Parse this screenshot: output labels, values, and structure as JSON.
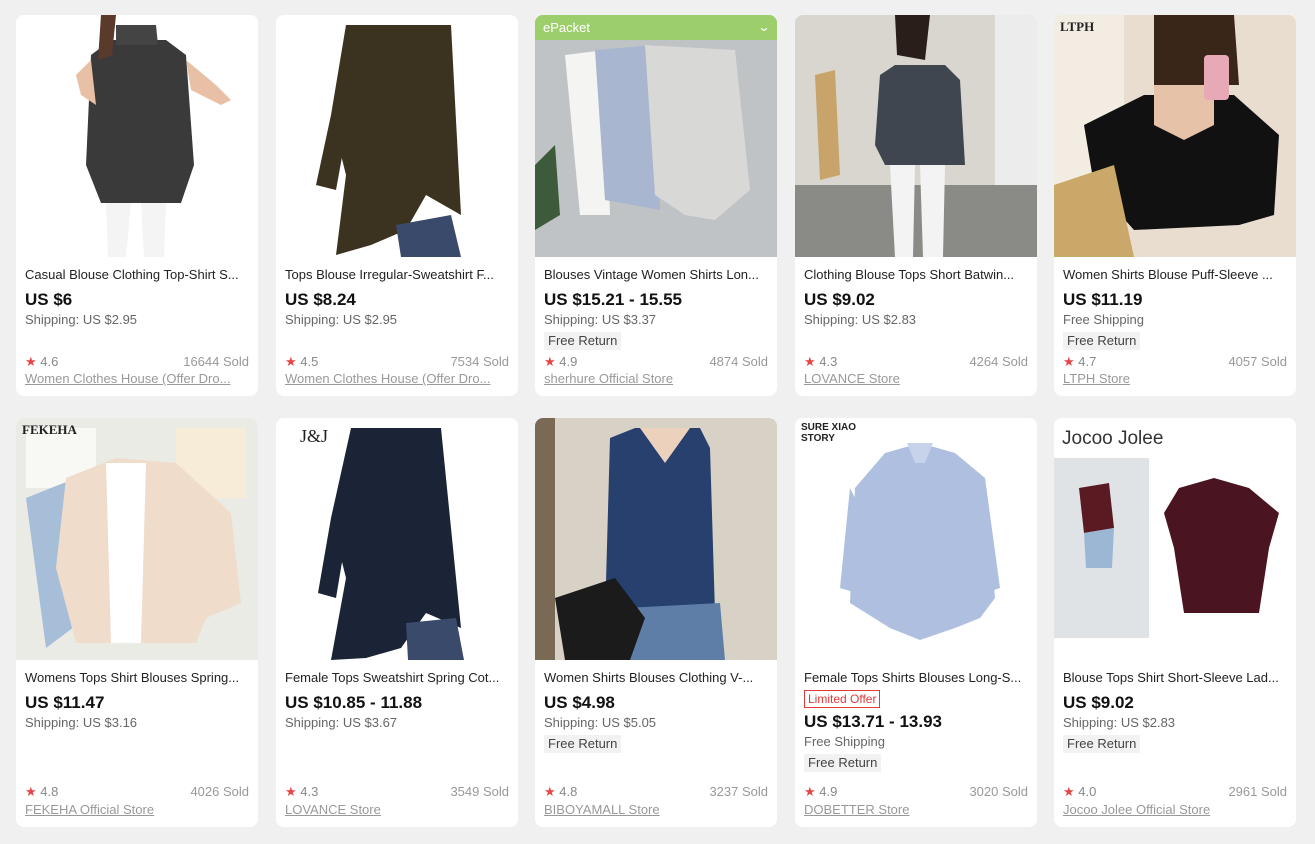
{
  "products": [
    {
      "title": "Casual Blouse Clothing Top-Shirt S...",
      "price": "US $6",
      "shipping": "Shipping: US $2.95",
      "rating": "4.6",
      "sold": "16644 Sold",
      "store": "Women Clothes House (Offer Dro...",
      "badge": "",
      "image_label": ""
    },
    {
      "title": "Tops Blouse Irregular-Sweatshirt F...",
      "price": "US $8.24",
      "shipping": "Shipping: US $2.95",
      "rating": "4.5",
      "sold": "7534 Sold",
      "store": "Women Clothes House (Offer Dro...",
      "badge": "",
      "image_label": ""
    },
    {
      "title": "Blouses Vintage Women Shirts Lon...",
      "price": "US $15.21 - 15.55",
      "shipping": "Shipping: US $3.37",
      "free_return": "Free Return",
      "rating": "4.9",
      "sold": "4874 Sold",
      "store": "sherhure Official Store",
      "badge": "ePacket",
      "image_label": ""
    },
    {
      "title": "Clothing Blouse Tops Short Batwin...",
      "price": "US $9.02",
      "shipping": "Shipping: US $2.83",
      "rating": "4.3",
      "sold": "4264 Sold",
      "store": "LOVANCE Store",
      "badge": "",
      "image_label": ""
    },
    {
      "title": "Women Shirts Blouse Puff-Sleeve ...",
      "price": "US $11.19",
      "shipping": "Free Shipping",
      "free_return": "Free Return",
      "rating": "4.7",
      "sold": "4057 Sold",
      "store": "LTPH Store",
      "badge": "",
      "image_label": "LTPH"
    },
    {
      "title": "Womens Tops Shirt Blouses Spring...",
      "price": "US $11.47",
      "shipping": "Shipping: US $3.16",
      "rating": "4.8",
      "sold": "4026 Sold",
      "store": "FEKEHA Official Store",
      "badge": "",
      "image_label": "FEKEHA"
    },
    {
      "title": "Female Tops Sweatshirt Spring Cot...",
      "price": "US $10.85 - 11.88",
      "shipping": "Shipping: US $3.67",
      "rating": "4.3",
      "sold": "3549 Sold",
      "store": "LOVANCE Store",
      "badge": "",
      "image_label": "J&J"
    },
    {
      "title": "Women Shirts Blouses Clothing V-...",
      "price": "US $4.98",
      "shipping": "Shipping: US $5.05",
      "free_return": "Free Return",
      "rating": "4.8",
      "sold": "3237 Sold",
      "store": "BIBOYAMALL Store",
      "badge": "",
      "image_label": ""
    },
    {
      "title": "Female Tops Shirts Blouses Long-S...",
      "limited": "Limited Offer",
      "price": "US $13.71 - 13.93",
      "shipping": "Free Shipping",
      "free_return": "Free Return",
      "rating": "4.9",
      "sold": "3020 Sold",
      "store": "DOBETTER Store",
      "badge": "",
      "image_label": "SURE XIAO STORY"
    },
    {
      "title": "Blouse Tops Shirt Short-Sleeve Lad...",
      "price": "US $9.02",
      "shipping": "Shipping: US $2.83",
      "free_return": "Free Return",
      "rating": "4.0",
      "sold": "2961 Sold",
      "store": "Jocoo Jolee Official Store",
      "badge": "",
      "image_label": "Jocoo Jolee"
    }
  ],
  "colors": {
    "page_bg": "#f0f0f0",
    "card_bg": "#ffffff",
    "star": "#e64545",
    "badge_green": "#9ccf6b",
    "limited_red": "#e03a3a"
  },
  "icons": {
    "rating": "star-icon",
    "badge_toggle": "chevron-down-icon"
  }
}
